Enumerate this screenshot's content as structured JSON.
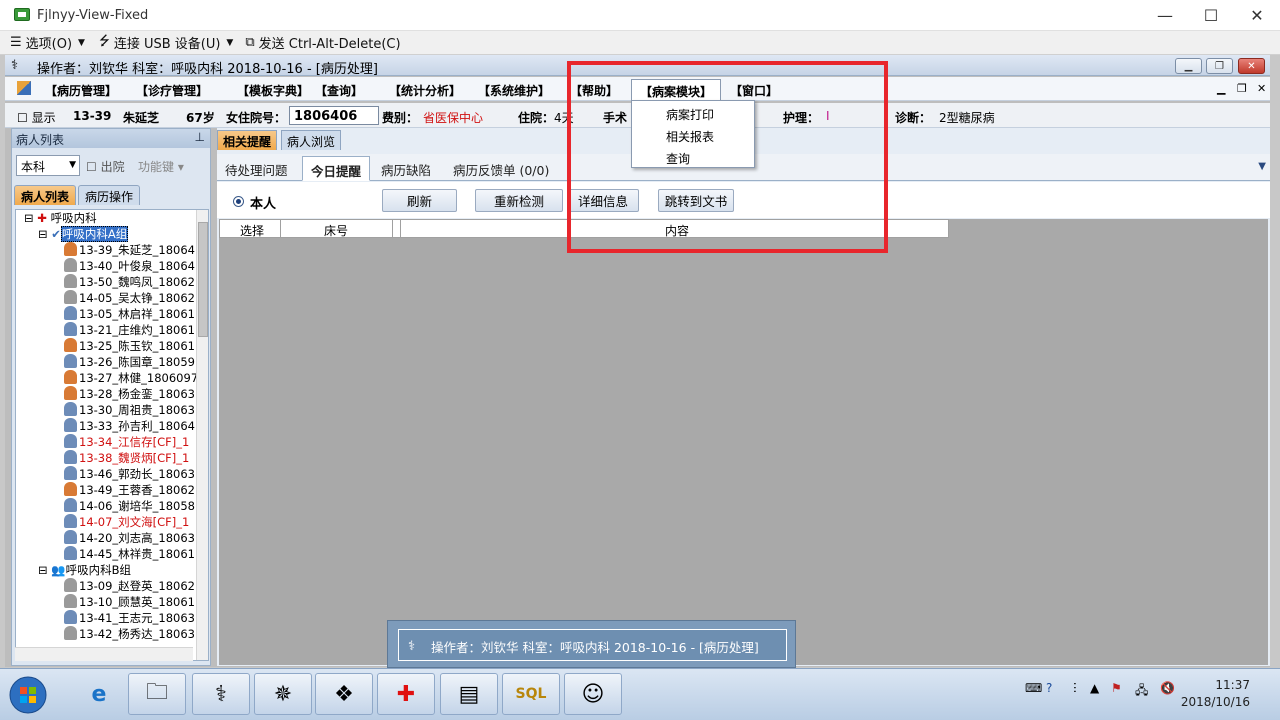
{
  "window": {
    "title": "Fjlnyy-View-Fixed",
    "min": "—",
    "max": "☐",
    "close": "✕"
  },
  "vmbar": {
    "options": "选项(O)",
    "usb": "连接 USB 设备(U)",
    "send": "发送 Ctrl-Alt-Delete(C)"
  },
  "app": {
    "title": "操作者：刘钦华   科室：呼吸内科   2018-10-16 - [病历处理]"
  },
  "menu": {
    "items": [
      "【病历管理】",
      "【诊疗管理】",
      "【模板字典】",
      "【查询】",
      "【统计分析】",
      "【系统维护】",
      "【帮助】",
      "【病案模块】",
      "【窗口】"
    ],
    "dropdown": [
      "病案打印",
      "相关报表",
      "查询"
    ]
  },
  "patient": {
    "show": "显示",
    "bed": "13-39",
    "name": "朱延芝",
    "age": "67岁",
    "inpatient_label": "女住院号：",
    "inpatient_no": "1806406",
    "fee_label": "费别：",
    "fee": "省医保中心",
    "stay_label": "住院：",
    "stay": "4天",
    "surgery_label": "手术",
    "nursing_label": "护理：",
    "nursing": "I",
    "diagnosis_label": "诊断：",
    "diagnosis": "2型糖尿病"
  },
  "left": {
    "header": "病人列表",
    "pin": "ᵖ",
    "dept": "本科",
    "discharge": "出院",
    "function": "功能键",
    "tabs": [
      "病人列表",
      "病历操作"
    ],
    "root": "呼吸内科",
    "groupA": "呼吸内科A组",
    "groupB": "呼吸内科B组",
    "patientsA": [
      {
        "t": "13-39_朱延芝_18064",
        "g": "f",
        "red": false
      },
      {
        "t": "13-40_叶俊泉_18064",
        "g": "g",
        "red": false
      },
      {
        "t": "13-50_魏鸣凤_18062",
        "g": "g",
        "red": false
      },
      {
        "t": "14-05_吴太铮_18062",
        "g": "g",
        "red": false
      },
      {
        "t": "13-05_林启祥_18061",
        "g": "m",
        "red": false
      },
      {
        "t": "13-21_庄维灼_18061",
        "g": "m",
        "red": false
      },
      {
        "t": "13-25_陈玉钦_18061",
        "g": "f",
        "red": false
      },
      {
        "t": "13-26_陈国章_18059",
        "g": "m",
        "red": false
      },
      {
        "t": "13-27_林健_1806097",
        "g": "f",
        "red": false
      },
      {
        "t": "13-28_杨金銮_18063",
        "g": "f",
        "red": false
      },
      {
        "t": "13-30_周祖贵_18063",
        "g": "m",
        "red": false
      },
      {
        "t": "13-33_孙吉利_18064",
        "g": "m",
        "red": false
      },
      {
        "t": "13-34_江信存[CF]_1",
        "g": "m",
        "red": true
      },
      {
        "t": "13-38_魏贤炳[CF]_1",
        "g": "m",
        "red": true
      },
      {
        "t": "13-46_郭劲长_18063",
        "g": "m",
        "red": false
      },
      {
        "t": "13-49_王蓉香_18062",
        "g": "f",
        "red": false
      },
      {
        "t": "14-06_谢培华_18058",
        "g": "m",
        "red": false
      },
      {
        "t": "14-07_刘文海[CF]_1",
        "g": "m",
        "red": true
      },
      {
        "t": "14-20_刘志高_18063",
        "g": "m",
        "red": false
      },
      {
        "t": "14-45_林祥贵_18061",
        "g": "m",
        "red": false
      }
    ],
    "patientsB": [
      {
        "t": "13-09_赵登英_18062",
        "g": "g",
        "red": false
      },
      {
        "t": "13-10_顾慧英_18061",
        "g": "g",
        "red": false
      },
      {
        "t": "13-41_王志元_18063",
        "g": "m",
        "red": false
      },
      {
        "t": "13-42_杨秀达_18063",
        "g": "g",
        "red": false
      }
    ]
  },
  "right": {
    "tabs": [
      "相关提醒",
      "病人浏览"
    ],
    "subtabs": [
      "待处理问题",
      "今日提醒",
      "病历缺陷",
      "病历反馈单 (0/0)"
    ],
    "radio": "本人",
    "buttons": [
      "刷新",
      "重新检测",
      "详细信息",
      "跳转到文书"
    ],
    "columns": [
      "选择",
      "床号",
      "内容"
    ]
  },
  "tooltip": "操作者：刘钦华   科室：呼吸内科   2018-10-16 - [病历处理]",
  "clock": {
    "time": "11:37",
    "date": "2018/10/16"
  },
  "colors": {
    "highlight": "#e8262c",
    "accent": "#f0a94c"
  }
}
